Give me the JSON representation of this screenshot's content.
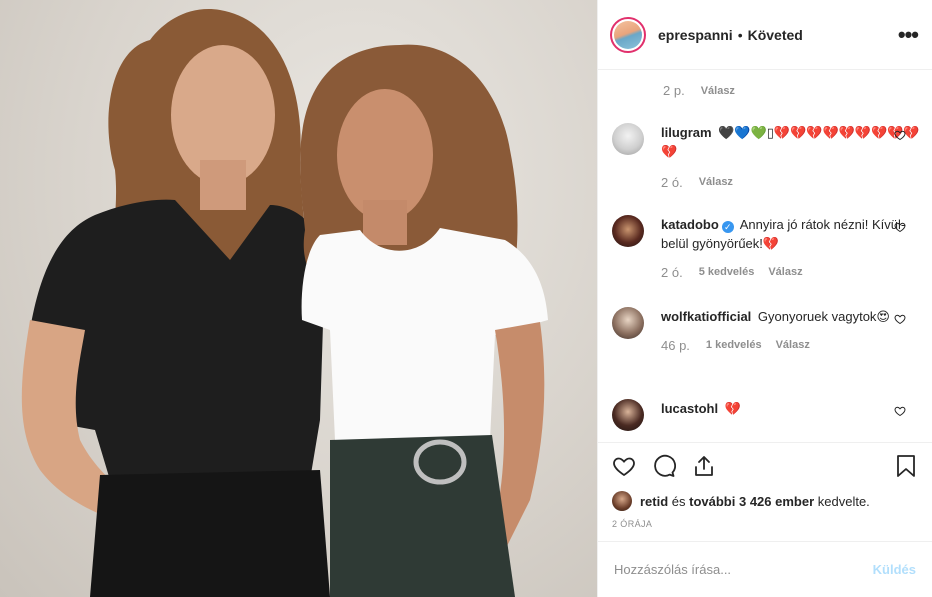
{
  "post": {
    "username": "eprespanni",
    "separator": "•",
    "follow_status": "Követed",
    "more": "•••"
  },
  "comments": {
    "top_meta": {
      "time": "2 p.",
      "reply": "Válasz"
    },
    "items": [
      {
        "username": "lilugram",
        "text": "🖤💙💚▯💔💔💔💔💔💔💔💔💔💔",
        "time": "2 ó.",
        "likes": "",
        "reply": "Válasz"
      },
      {
        "username": "katadobo",
        "verified": true,
        "text": "Annyira jó rátok nézni! Kívül-belül gyönyörűek!💔",
        "time": "2 ó.",
        "likes": "5 kedvelés",
        "reply": "Válasz"
      },
      {
        "username": "wolfkatiofficial",
        "text": "Gyonyoruek vagytok😍",
        "time": "46 p.",
        "likes": "1 kedvelés",
        "reply": "Válasz"
      },
      {
        "username": "lucastohl",
        "text": "💔",
        "time": "",
        "likes": "",
        "reply": ""
      }
    ]
  },
  "likes": {
    "liker": "retid",
    "rest_prefix": " és ",
    "rest_bold": "további 3 426 ember",
    "rest_suffix": " kedvelte."
  },
  "posted_ago": "2 ÓRÁJA",
  "add_comment": {
    "placeholder": "Hozzászólás írása...",
    "send_label": "Küldés"
  },
  "colors": {
    "send_disabled": "#b2dffc",
    "story_ring": "#e1306c",
    "verified": "#3897f0",
    "meta_gray": "#8e8e8e"
  }
}
